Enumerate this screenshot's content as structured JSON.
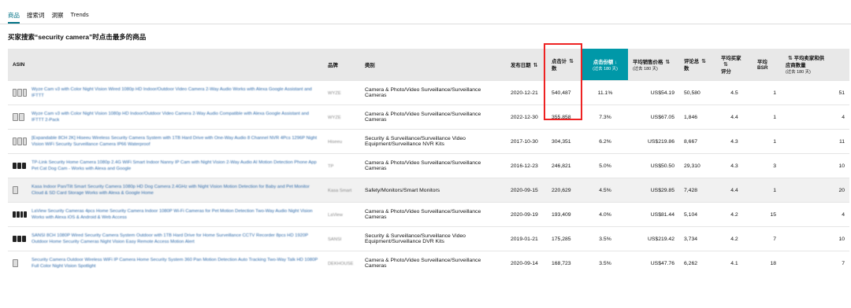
{
  "tabs": [
    "商品",
    "搜索词",
    "洞察",
    "Trends"
  ],
  "heading": "买家搜索“security camera”时点击最多的商品",
  "columns": {
    "asin": "ASIN",
    "brand": "品牌",
    "category": "类别",
    "release": "发布日期",
    "clicks_a": "点击计",
    "clicks_b": "数",
    "share": "点击份额",
    "share_sub": "(过去 180 天)",
    "price": "平均销售价格",
    "price_sub": "(过去 180 天)",
    "reviews_a": "评论总",
    "reviews_b": "数",
    "rating_a": "平均买家",
    "rating_b": "评分",
    "bsr_a": "平均",
    "bsr_b": "BSR",
    "sellers_a": "平均卖家和供",
    "sellers_b": "应商数量",
    "sellers_sub": "(过去 180 天)"
  },
  "rows": [
    {
      "title": "Wyze Cam v3 with Color Night Vision Wired 1080p HD Indoor/Outdoor Video Camera 2-Way Audio Works with Alexa Google Assistant and IFTTT",
      "brand": "WYZE",
      "cat_a": "Camera & Photo/Video Surveillance/Surveillance",
      "cat_b": "Cameras",
      "date": "2020-12-21",
      "clicks": "540,487",
      "share": "11.1%",
      "price": "US$54.19",
      "reviews": "50,580",
      "rating": "4.5",
      "bsr": "1",
      "sellers": "51"
    },
    {
      "title": "Wyze Cam v3 with Color Night Vision 1080p HD Indoor/Outdoor Video Camera 2-Way Audio Compatible with Alexa Google Assistant and IFTTT 2-Pack",
      "brand": "WYZE",
      "cat_a": "Camera & Photo/Video Surveillance/Surveillance",
      "cat_b": "Cameras",
      "date": "2022-12-30",
      "clicks": "355,858",
      "share": "7.3%",
      "price": "US$67.05",
      "reviews": "1,846",
      "rating": "4.4",
      "bsr": "1",
      "sellers": "4"
    },
    {
      "title": "[Expandable 8CH 2K] Hiseeu Wireless Security Camera System with 1TB Hard Drive with One-Way Audio 8 Channel NVR 4Pcs 1296P Night Vision WiFi Security Surveillance Camera IP66 Waterproof",
      "brand": "Hiseeu",
      "cat_a": "Security & Surveillance/Surveillance Video",
      "cat_b": "Equipment/Surveillance NVR Kits",
      "date": "2017-10-30",
      "clicks": "304,351",
      "share": "6.2%",
      "price": "US$219.86",
      "reviews": "8,667",
      "rating": "4.3",
      "bsr": "1",
      "sellers": "11"
    },
    {
      "title": "TP-Link Security Home Camera 1080p 2.4G WiFi Smart Indoor Nanny IP Cam with Night Vision 2-Way Audio AI Motion Detection Phone App Pet Cat Dog Cam - Works with Alexa and Google",
      "brand": "TP",
      "cat_a": "Camera & Photo/Video Surveillance/Surveillance",
      "cat_b": "Cameras",
      "date": "2016-12-23",
      "clicks": "246,821",
      "share": "5.0%",
      "price": "US$50.50",
      "reviews": "29,310",
      "rating": "4.3",
      "bsr": "3",
      "sellers": "10"
    },
    {
      "title": "Kasa Indoor Pan/Tilt Smart Security Camera 1080p HD Dog Camera 2.4GHz with Night Vision Motion Detection for Baby and Pet Monitor Cloud & SD Card Storage Works with Alexa & Google Home",
      "brand": "Kasa Smart",
      "cat_a": "Safety/Monitors/Smart Monitors",
      "cat_b": "",
      "date": "2020-09-15",
      "clicks": "220,629",
      "share": "4.5%",
      "price": "US$29.85",
      "reviews": "7,428",
      "rating": "4.4",
      "bsr": "1",
      "sellers": "20"
    },
    {
      "title": "LaView Security Cameras 4pcs Home Security Camera Indoor 1080P Wi-Fi Cameras for Pet Motion Detection Two-Way Audio Night Vision Works with Alexa iOS & Android & Web Access",
      "brand": "LaView",
      "cat_a": "Camera & Photo/Video Surveillance/Surveillance",
      "cat_b": "Cameras",
      "date": "2020-09-19",
      "clicks": "193,409",
      "share": "4.0%",
      "price": "US$81.44",
      "reviews": "5,104",
      "rating": "4.2",
      "bsr": "15",
      "sellers": "4"
    },
    {
      "title": "SANSI 8CH 1080P Wired Security Camera System Outdoor with 1TB Hard Drive for Home Surveillance CCTV Recorder 8pcs HD 1920P Outdoor Home Security Cameras Night Vision Easy Remote Access Motion Alert",
      "brand": "SANSI",
      "cat_a": "Security & Surveillance/Surveillance Video",
      "cat_b": "Equipment/Surveillance DVR Kits",
      "date": "2019-01-21",
      "clicks": "175,285",
      "share": "3.5%",
      "price": "US$219.42",
      "reviews": "3,734",
      "rating": "4.2",
      "bsr": "7",
      "sellers": "10"
    },
    {
      "title": "Security Camera Outdoor Wireless WiFi IP Camera Home Security System 360 Pan Motion Detection Auto Tracking Two-Way Talk HD 1080P Full Color Night Vision Spotlight",
      "brand": "DEKHOUSE",
      "cat_a": "Camera & Photo/Video Surveillance/Surveillance",
      "cat_b": "Cameras",
      "date": "2020-09-14",
      "clicks": "168,723",
      "share": "3.5%",
      "price": "US$47.76",
      "reviews": "6,262",
      "rating": "4.1",
      "bsr": "18",
      "sellers": "7"
    }
  ],
  "sort_icon": "sort-arrows-icon",
  "sort_active_icon": "arrow-down-icon",
  "accent_color": "#0098a8",
  "highlight_color": "#e22222"
}
